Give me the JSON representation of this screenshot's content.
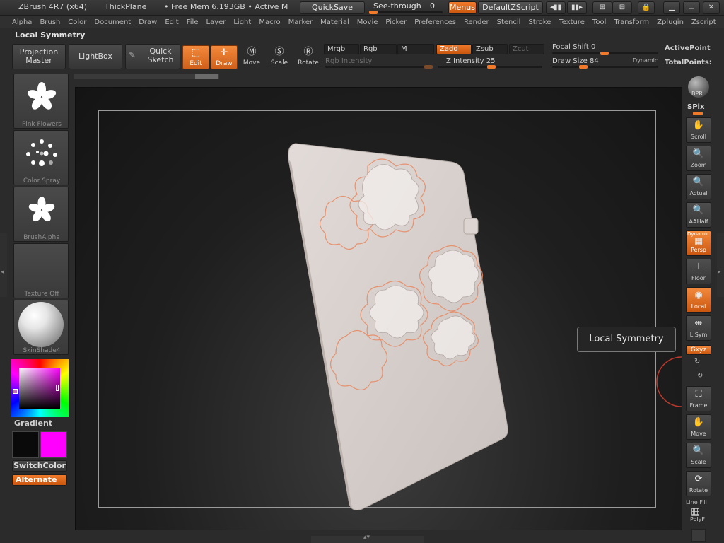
{
  "titlebar": {
    "app": "ZBrush 4R7 (x64)",
    "document": "ThickPlane",
    "mem": "• Free Mem 6.193GB • Active M",
    "quicksave": "QuickSave",
    "seethrough_label": "See-through",
    "seethrough_value": "0",
    "see_through_level": 0,
    "menus": "Menus",
    "script": "DefaultZScript"
  },
  "menubar": [
    "Alpha",
    "Brush",
    "Color",
    "Document",
    "Draw",
    "Edit",
    "File",
    "Layer",
    "Light",
    "Macro",
    "Marker",
    "Material",
    "Movie",
    "Picker",
    "Preferences",
    "Render",
    "Stencil",
    "Stroke",
    "Texture",
    "Tool",
    "Transform",
    "Zplugin",
    "Zscript"
  ],
  "palette_title": "Local Symmetry",
  "shelf": {
    "projection_master": "Projection Master",
    "lightbox": "LightBox",
    "quick_sketch": "Quick Sketch",
    "edit": "Edit",
    "draw": "Draw",
    "move": "Move",
    "scale": "Scale",
    "rotate": "Rotate",
    "mrgb": "Mrgb",
    "rgb": "Rgb",
    "m": "M",
    "rgb_intensity": "Rgb Intensity",
    "zadd": "Zadd",
    "zsub": "Zsub",
    "zcut": "Zcut",
    "z_intensity": "Z Intensity 25",
    "focal_shift": "Focal Shift 0",
    "draw_size": "Draw Size 84",
    "dynamic": "Dynamic",
    "active_points": "ActivePoint",
    "total_points": "TotalPoints:"
  },
  "left_tray": {
    "brush": "Pink Flowers",
    "stroke": "Color Spray",
    "alpha": "BrushAlpha",
    "texture": "Texture Off",
    "material": "SkinShade4",
    "gradient": "Gradient",
    "switch_color": "SwitchColor",
    "alternate": "Alternate"
  },
  "right_tray": {
    "bpr": "BPR",
    "spix": "SPix",
    "scroll": "Scroll",
    "zoom": "Zoom",
    "actual": "Actual",
    "aahalf": "AAHalf",
    "dynamic": "Dynamic",
    "persp": "Persp",
    "floor": "Floor",
    "local": "Local",
    "lsym": "L.Sym",
    "xyz": "Gxyz",
    "frame": "Frame",
    "move": "Move",
    "scale": "Scale",
    "rotate": "Rotate",
    "linefill": "Line Fill",
    "polyf": "PolyF"
  },
  "tooltip": "Local Symmetry",
  "colors": {
    "accent": "#f07a2a",
    "primary_color": "#0a0a0a",
    "secondary_color": "#ff00ff"
  }
}
